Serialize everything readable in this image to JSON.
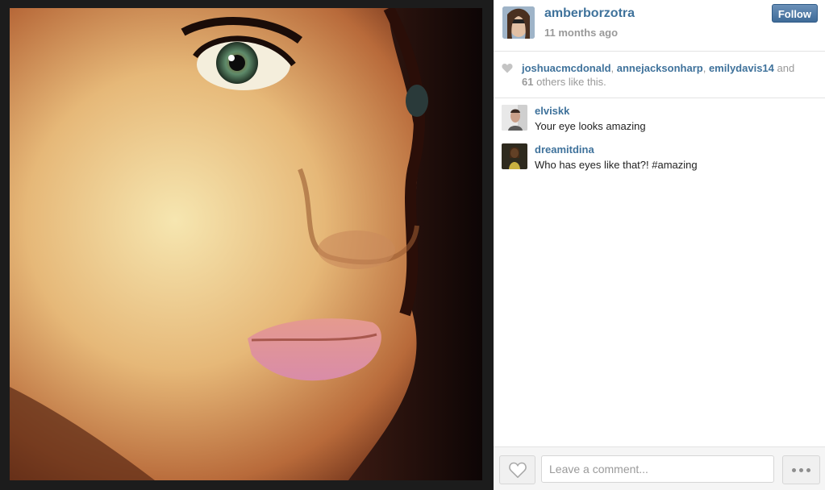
{
  "post": {
    "photo_icon": "portrait-photo",
    "author": "amberborzotra",
    "time_ago": "11 months ago",
    "follow_label": "Follow"
  },
  "likes": {
    "users": [
      "joshuacmcdonald",
      "annejacksonharp",
      "emilydavis14"
    ],
    "and_text": "and",
    "others_count": "61",
    "others_text": "others like this."
  },
  "comments": [
    {
      "user": "elviskk",
      "text": "Your eye looks amazing"
    },
    {
      "user": "dreamitdina",
      "text": "Who has eyes like that?! #amazing"
    }
  ],
  "composer": {
    "placeholder": "Leave a comment...",
    "like_icon": "heart-icon",
    "more_icon": "ellipsis-icon"
  },
  "colors": {
    "link": "#3f729b",
    "follow_button": "#3f6b98",
    "muted": "#999999"
  }
}
